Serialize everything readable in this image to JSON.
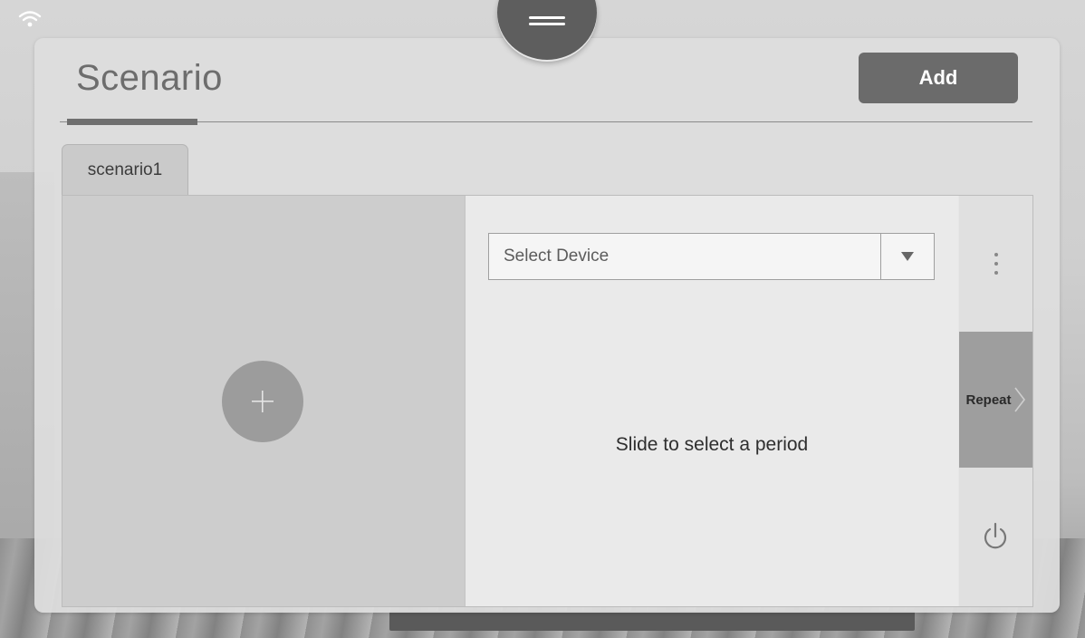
{
  "header": {
    "title": "Scenario",
    "add_label": "Add"
  },
  "tabs": [
    {
      "label": "scenario1",
      "selected": true
    }
  ],
  "device_select": {
    "placeholder": "Select Device"
  },
  "hint_text": "Slide to select a period",
  "side_controls": {
    "repeat_label": "Repeat"
  },
  "icons": {
    "status": "wifi-icon",
    "handle": "menu-lines-icon",
    "add_scene": "plus-icon",
    "dropdown": "triangle-down-icon",
    "more": "vertical-dots-icon",
    "repeat": "chevron-right-icon",
    "power": "power-icon"
  },
  "colors": {
    "button_dark": "#6b6b6b",
    "panel": "#dedede",
    "repeat_bg": "#9e9e9e"
  }
}
